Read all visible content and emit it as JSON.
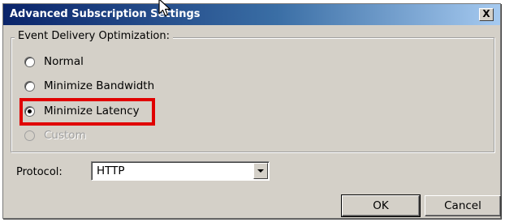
{
  "window": {
    "title": "Advanced Subscription Settings",
    "close_label": "X"
  },
  "delivery": {
    "legend": "Event Delivery Optimization:",
    "options": [
      {
        "label": "Normal",
        "checked": false,
        "enabled": true
      },
      {
        "label": "Minimize Bandwidth",
        "checked": false,
        "enabled": true
      },
      {
        "label": "Minimize Latency",
        "checked": true,
        "enabled": true
      },
      {
        "label": "Custom",
        "checked": false,
        "enabled": false
      }
    ]
  },
  "protocol": {
    "label": "Protocol:",
    "value": "HTTP"
  },
  "buttons": {
    "ok": "OK",
    "cancel": "Cancel"
  },
  "colors": {
    "highlight": "#e00000",
    "titlebar_start": "#0a246a",
    "dialog_bg": "#d4d0c8"
  },
  "icons": {
    "cursor": "mouse-pointer-icon",
    "dropdown": "chevron-down-icon"
  }
}
